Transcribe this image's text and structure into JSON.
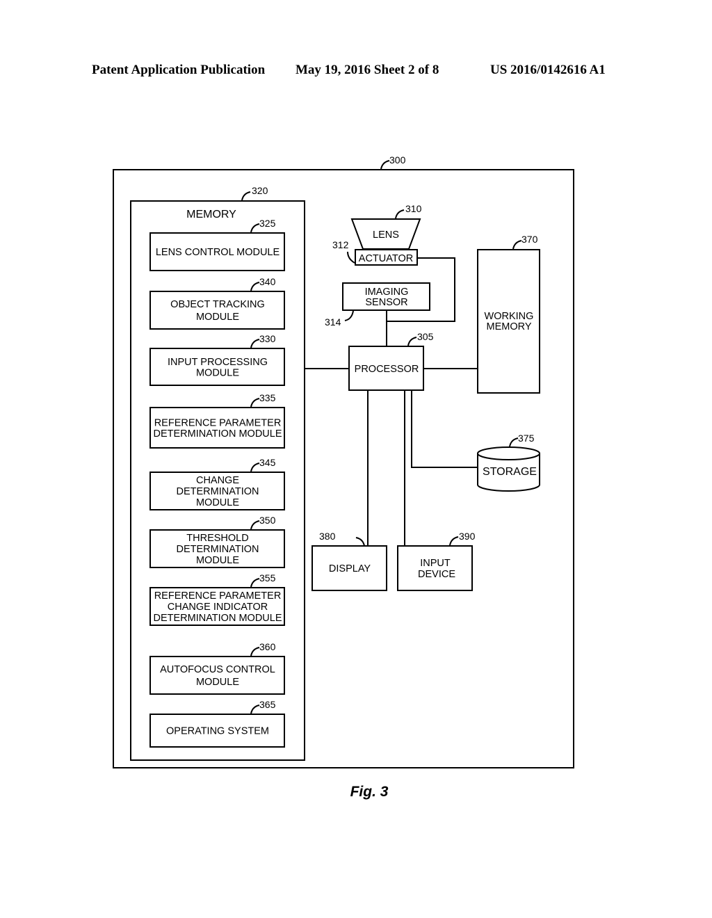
{
  "header": {
    "publication": "Patent Application Publication",
    "date_sheet": "May 19, 2016  Sheet 2 of 8",
    "number": "US 2016/0142616 A1"
  },
  "figure": {
    "caption": "Fig. 3",
    "system_ref": "300",
    "memory": {
      "ref": "320",
      "title": "MEMORY",
      "modules": [
        {
          "ref": "325",
          "lines": [
            "LENS CONTROL MODULE"
          ]
        },
        {
          "ref": "340",
          "lines": [
            "OBJECT TRACKING",
            "MODULE"
          ]
        },
        {
          "ref": "330",
          "lines": [
            "INPUT PROCESSING",
            "MODULE"
          ]
        },
        {
          "ref": "335",
          "lines": [
            "REFERENCE PARAMETER",
            "DETERMINATION MODULE"
          ]
        },
        {
          "ref": "345",
          "lines": [
            "CHANGE",
            "DETERMINATION",
            "MODULE"
          ]
        },
        {
          "ref": "350",
          "lines": [
            "THRESHOLD",
            "DETERMINATION",
            "MODULE"
          ]
        },
        {
          "ref": "355",
          "lines": [
            "REFERENCE PARAMETER",
            "CHANGE INDICATOR",
            "DETERMINATION MODULE"
          ]
        },
        {
          "ref": "360",
          "lines": [
            "AUTOFOCUS CONTROL",
            "MODULE"
          ]
        },
        {
          "ref": "365",
          "lines": [
            "OPERATING SYSTEM"
          ]
        }
      ]
    },
    "lens": {
      "ref": "310",
      "label": "LENS"
    },
    "actuator": {
      "ref": "312",
      "label": "ACTUATOR"
    },
    "imaging_sensor": {
      "ref": "314",
      "lines": [
        "IMAGING",
        "SENSOR"
      ]
    },
    "processor": {
      "ref": "305",
      "label": "PROCESSOR"
    },
    "working_memory": {
      "ref": "370",
      "lines": [
        "WORKING",
        "MEMORY"
      ]
    },
    "storage": {
      "ref": "375",
      "label": "STORAGE"
    },
    "display": {
      "ref": "380",
      "label": "DISPLAY"
    },
    "input_device": {
      "ref": "390",
      "lines": [
        "INPUT",
        "DEVICE"
      ]
    }
  }
}
